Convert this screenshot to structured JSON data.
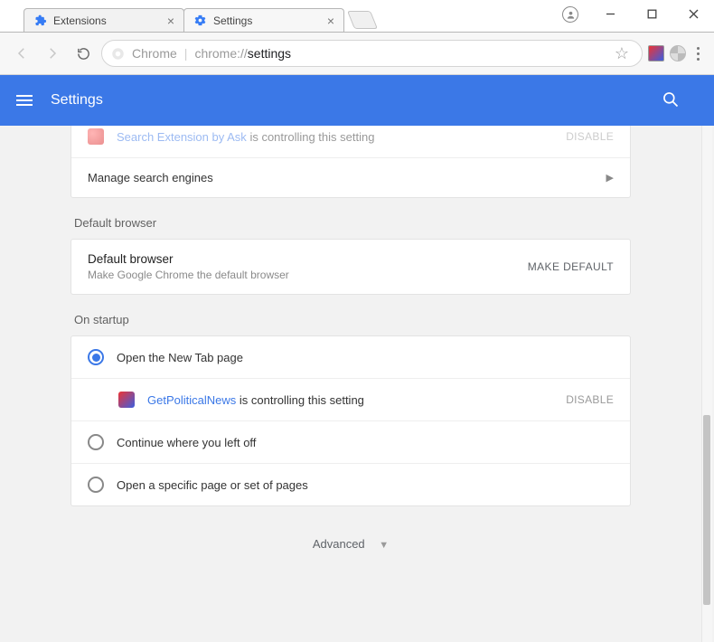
{
  "window": {
    "profile_icon": "person-icon",
    "minimize": "–",
    "maximize": "☐",
    "close": "✕"
  },
  "tabs": [
    {
      "title": "Extensions",
      "icon": "puzzle-icon"
    },
    {
      "title": "Settings",
      "icon": "gear-icon"
    }
  ],
  "newtab_label": "",
  "omnibox": {
    "scheme_label": "Chrome",
    "dim_prefix": "chrome://",
    "path": "settings"
  },
  "blueheader": {
    "title": "Settings"
  },
  "search_section": {
    "controlling_ext_name": "Search Extension by Ask",
    "controlling_suffix": "is controlling this setting",
    "disable_label": "DISABLE",
    "manage_label": "Manage search engines"
  },
  "default_browser": {
    "section": "Default browser",
    "row_title": "Default browser",
    "row_sub": "Make Google Chrome the default browser",
    "button": "MAKE DEFAULT"
  },
  "on_startup": {
    "section": "On startup",
    "options": [
      "Open the New Tab page",
      "Continue where you left off",
      "Open a specific page or set of pages"
    ],
    "controlling_ext_name": "GetPoliticalNews",
    "controlling_suffix": "is controlling this setting",
    "disable_label": "DISABLE"
  },
  "advanced_label": "Advanced"
}
